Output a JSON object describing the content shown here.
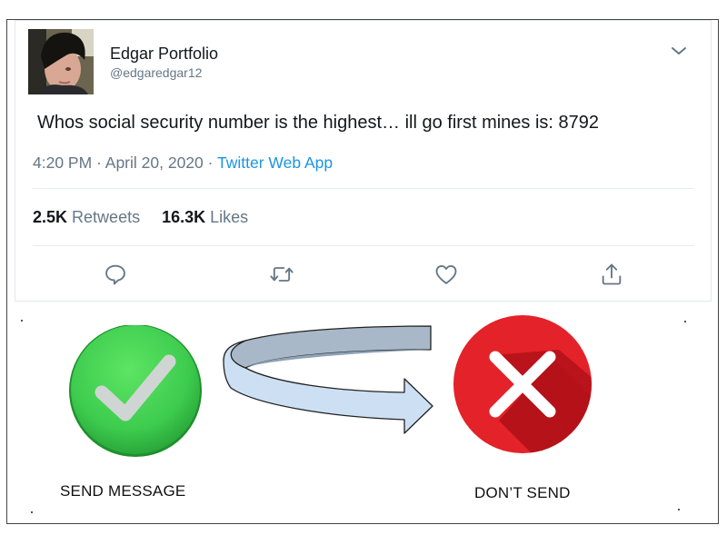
{
  "tweet": {
    "display_name": "Edgar Portfolio",
    "handle": "@edgaredgar12",
    "text": "Whos social security number is the highest… ill go first mines is: 8792",
    "time": "4:20 PM",
    "date": "April 20, 2020",
    "separator": " · ",
    "source": "Twitter Web App",
    "retweets_count": "2.5K",
    "retweets_label": "Retweets",
    "likes_count": "16.3K",
    "likes_label": "Likes",
    "icons": {
      "more": "chevron-down-icon",
      "reply": "reply-icon",
      "retweet": "retweet-icon",
      "like": "heart-icon",
      "share": "share-icon"
    }
  },
  "meme": {
    "send_label": "SEND MESSAGE",
    "dont_send_label": "DON’T SEND",
    "icons": {
      "send": "green-checkmark-icon",
      "dont_send": "red-x-icon",
      "arrow": "curved-arrow-icon"
    },
    "colors": {
      "green": "#3ecc4f",
      "red": "#d9171d",
      "arrow_fill": "#cde0f3",
      "arrow_shade": "#a8b8c8"
    }
  }
}
